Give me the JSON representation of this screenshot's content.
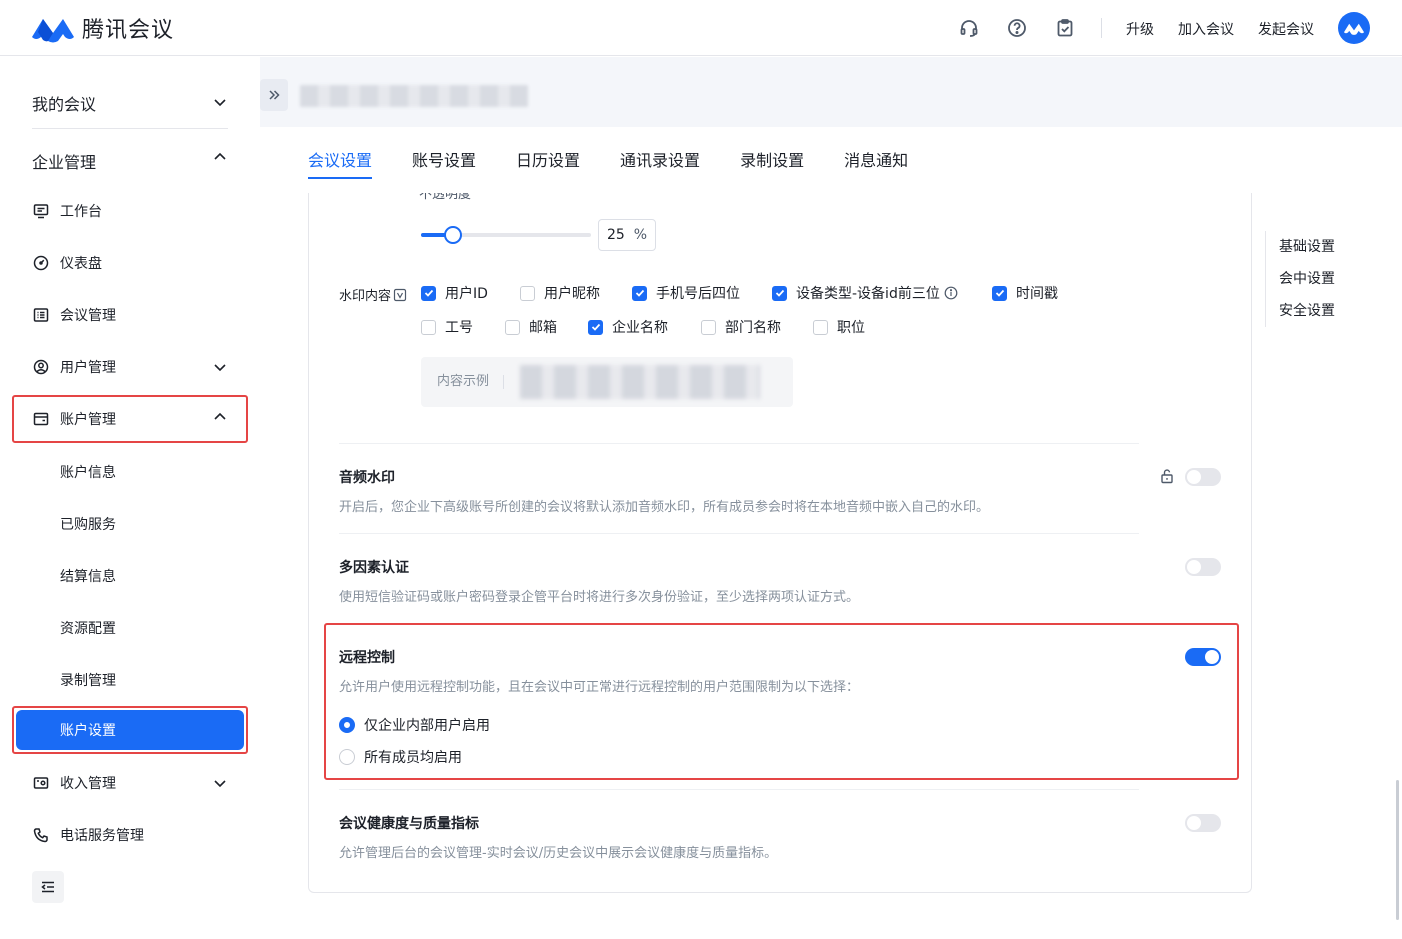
{
  "app": {
    "name": "腾讯会议",
    "brand_color": "#1a6bf5"
  },
  "topbar": {
    "icons": [
      "headset-icon",
      "help-icon",
      "clipboard-check-icon"
    ],
    "upgrade": "升级",
    "join": "加入会议",
    "start": "发起会议"
  },
  "sidebar": {
    "my_meetings": "我的会议",
    "enterprise": "企业管理",
    "items": {
      "workbench": "工作台",
      "dashboard": "仪表盘",
      "meeting_mgmt": "会议管理",
      "user_mgmt": "用户管理",
      "account_mgmt": "账户管理",
      "account_info": "账户信息",
      "purchased": "已购服务",
      "billing": "结算信息",
      "resources": "资源配置",
      "recording": "录制管理",
      "account_settings": "账户设置",
      "revenue": "收入管理",
      "phone": "电话服务管理"
    }
  },
  "tabs": [
    {
      "label": "会议设置",
      "active": true
    },
    {
      "label": "账号设置",
      "active": false
    },
    {
      "label": "日历设置",
      "active": false
    },
    {
      "label": "通讯录设置",
      "active": false
    },
    {
      "label": "录制设置",
      "active": false
    },
    {
      "label": "消息通知",
      "active": false
    }
  ],
  "watermark": {
    "opacity_label": "不透明度",
    "opacity_value": "25",
    "opacity_unit": "%",
    "content_label": "水印内容",
    "options_row1": [
      {
        "label": "用户ID",
        "checked": true
      },
      {
        "label": "用户昵称",
        "checked": false
      },
      {
        "label": "手机号后四位",
        "checked": true
      },
      {
        "label": "设备类型-设备id前三位",
        "checked": true
      },
      {
        "label": "时间戳",
        "checked": true
      }
    ],
    "options_row2": [
      {
        "label": "工号",
        "checked": false
      },
      {
        "label": "邮箱",
        "checked": false
      },
      {
        "label": "企业名称",
        "checked": true
      },
      {
        "label": "部门名称",
        "checked": false
      },
      {
        "label": "职位",
        "checked": false
      }
    ],
    "sample_label": "内容示例"
  },
  "settings": {
    "audio_wm": {
      "title": "音频水印",
      "desc": "开启后，您企业下高级账号所创建的会议将默认添加音频水印，所有成员参会时将在本地音频中嵌入自己的水印。",
      "on": false
    },
    "mfa": {
      "title": "多因素认证",
      "desc": "使用短信验证码或账户密码登录企管平台时将进行多次身份验证，至少选择两项认证方式。",
      "on": false
    },
    "remote": {
      "title": "远程控制",
      "desc": "允许用户使用远程控制功能，且在会议中可正常进行远程控制的用户范围限制为以下选择：",
      "on": true,
      "options": [
        {
          "label": "仅企业内部用户启用",
          "selected": true
        },
        {
          "label": "所有成员均启用",
          "selected": false
        }
      ]
    },
    "health": {
      "title": "会议健康度与质量指标",
      "desc": "允许管理后台的会议管理-实时会议/历史会议中展示会议健康度与质量指标。",
      "on": false
    }
  },
  "anchors": [
    "基础设置",
    "会中设置",
    "安全设置"
  ],
  "colors": {
    "accent": "#1a6bf5",
    "highlight_border": "#e54545"
  }
}
